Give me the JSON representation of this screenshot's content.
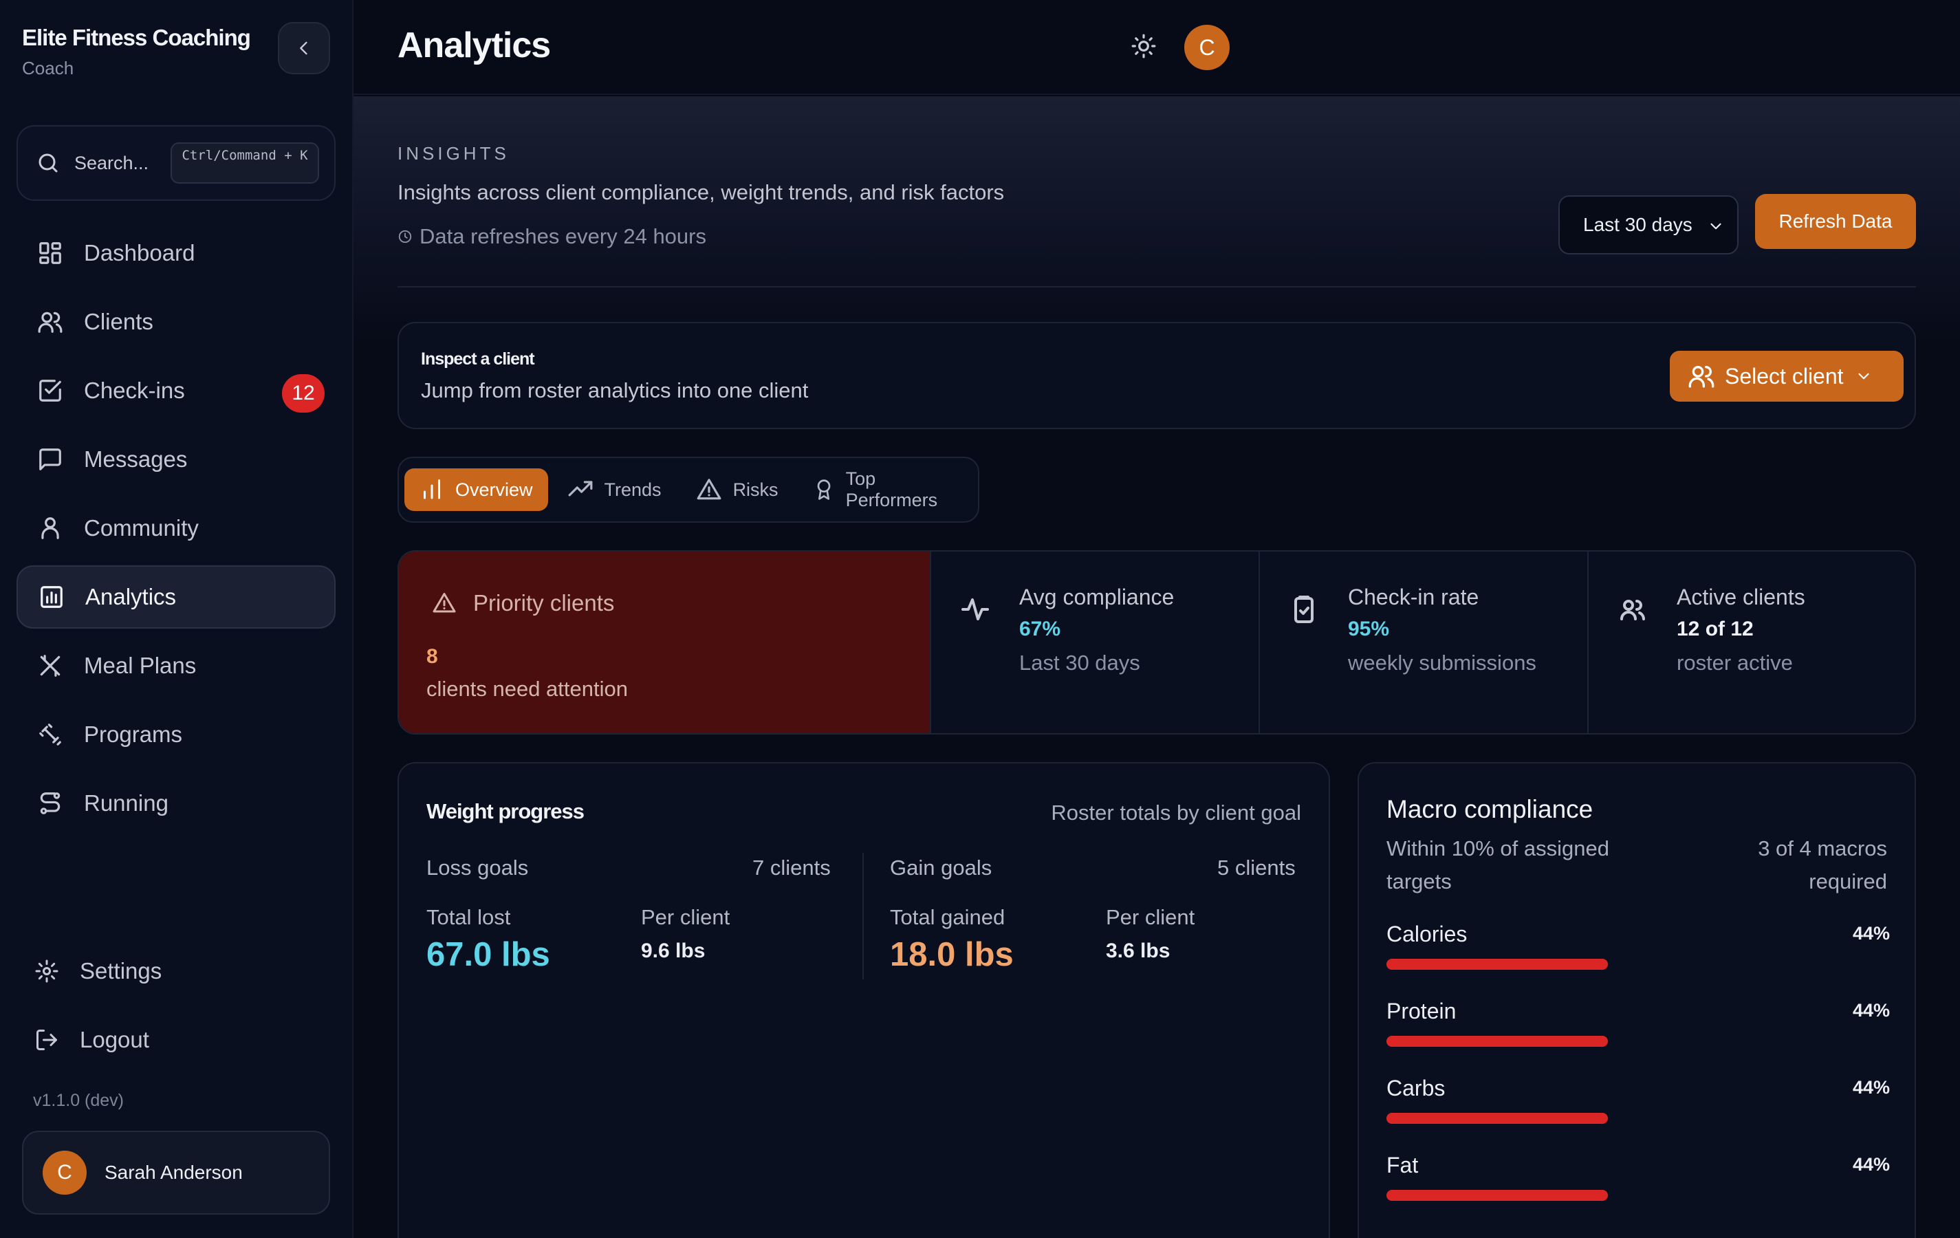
{
  "sidebar": {
    "brand": "Elite Fitness Coaching",
    "role": "Coach",
    "search_label": "Search...",
    "search_shortcut": "Ctrl/Command + K",
    "items": [
      {
        "label": "Dashboard",
        "icon": "grid-icon"
      },
      {
        "label": "Clients",
        "icon": "users-icon"
      },
      {
        "label": "Check-ins",
        "icon": "checkbox-icon",
        "badge": "12"
      },
      {
        "label": "Messages",
        "icon": "message-icon"
      },
      {
        "label": "Community",
        "icon": "community-icon"
      },
      {
        "label": "Analytics",
        "icon": "chart-icon",
        "active": true
      },
      {
        "label": "Meal Plans",
        "icon": "utensils-icon"
      },
      {
        "label": "Programs",
        "icon": "dumbbell-icon"
      },
      {
        "label": "Running",
        "icon": "route-icon"
      }
    ],
    "bottom_items": [
      {
        "label": "Settings",
        "icon": "gear-icon"
      },
      {
        "label": "Logout",
        "icon": "logout-icon"
      }
    ],
    "version": "v1.1.0 (dev)",
    "user": {
      "initial": "C",
      "name": "Sarah Anderson"
    }
  },
  "header": {
    "title": "Analytics",
    "avatar_initial": "C"
  },
  "insights": {
    "eyebrow": "INSIGHTS",
    "subtitle": "Insights across client compliance, weight trends, and risk factors",
    "refresh_note": "Data refreshes every 24 hours",
    "range_selected": "Last 30 days",
    "refresh_button": "Refresh Data"
  },
  "inspect": {
    "title": "Inspect a client",
    "subtitle": "Jump from roster analytics into one client",
    "button": "Select client"
  },
  "tabs": [
    {
      "label": "Overview",
      "active": true
    },
    {
      "label": "Trends"
    },
    {
      "label": "Risks"
    },
    {
      "label": "Top Performers"
    }
  ],
  "stats": {
    "priority": {
      "title": "Priority clients",
      "count": "8",
      "desc": "clients need attention"
    },
    "cards": [
      {
        "title": "Avg compliance",
        "value": "67%",
        "sub": "Last 30 days",
        "value_color": "#5fd3e8"
      },
      {
        "title": "Check-in rate",
        "value": "95%",
        "sub": "weekly submissions",
        "value_color": "#5fd3e8"
      },
      {
        "title": "Active clients",
        "value": "12 of 12",
        "sub": "roster active",
        "value_color": "#f1f2f6"
      }
    ]
  },
  "weight": {
    "title": "Weight progress",
    "note": "Roster totals by client goal",
    "loss": {
      "label": "Loss goals",
      "count": "7 clients",
      "total_label": "Total lost",
      "total": "67.0 lbs",
      "per_label": "Per client",
      "per": "9.6 lbs"
    },
    "gain": {
      "label": "Gain goals",
      "count": "5 clients",
      "total_label": "Total gained",
      "total": "18.0 lbs",
      "per_label": "Per client",
      "per": "3.6 lbs"
    },
    "loss_color": "#5fd3e8",
    "gain_color": "#f2a56a"
  },
  "macro": {
    "title": "Macro compliance",
    "subtitle": "Within 10% of assigned targets",
    "required": "3 of 4 macros required",
    "items": [
      {
        "name": "Calories",
        "pct": "44%",
        "value": 44
      },
      {
        "name": "Protein",
        "pct": "44%",
        "value": 44
      },
      {
        "name": "Carbs",
        "pct": "44%",
        "value": 44
      },
      {
        "name": "Fat",
        "pct": "44%",
        "value": 44
      }
    ],
    "bar_color": "#dc2626"
  },
  "colors": {
    "accent": "#c8661c",
    "badge": "#dc2626",
    "priority_bg": "#4b0e0e"
  }
}
